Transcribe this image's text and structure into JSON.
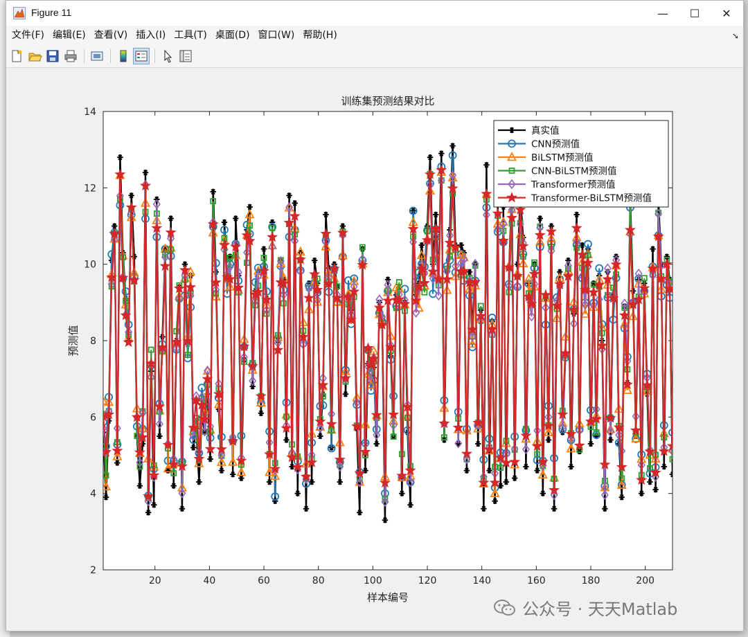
{
  "window": {
    "title": "Figure 11",
    "minimize_label": "—",
    "maximize_label": "☐",
    "close_label": "✕"
  },
  "menu": [
    "文件(F)",
    "编辑(E)",
    "查看(V)",
    "插入(I)",
    "工具(T)",
    "桌面(D)",
    "窗口(W)",
    "帮助(H)"
  ],
  "toolbar": {
    "icons": [
      "new-figure-icon",
      "open-file-icon",
      "save-icon",
      "print-icon",
      "link-plot-icon",
      "insert-colorbar-icon",
      "insert-legend-icon",
      "edit-plot-arrow-icon",
      "property-inspector-icon"
    ]
  },
  "watermark": "公众号 · 天天Matlab",
  "chart_data": {
    "type": "line",
    "title": "训练集预测结果对比",
    "xlabel": "样本编号",
    "ylabel": "预测值",
    "xlim": [
      1,
      210
    ],
    "ylim": [
      2,
      14
    ],
    "xticks": [
      20,
      40,
      60,
      80,
      100,
      120,
      140,
      160,
      180,
      200
    ],
    "yticks": [
      2,
      4,
      6,
      8,
      10,
      12,
      14
    ],
    "grid": false,
    "legend_position": "top-right",
    "series": [
      {
        "name": "真实值",
        "color": "#000000",
        "marker": "asterisk"
      },
      {
        "name": "CNN预测值",
        "color": "#1f77b4",
        "marker": "circle"
      },
      {
        "name": "BiLSTM预测值",
        "color": "#ff7f0e",
        "marker": "triangle"
      },
      {
        "name": "CNN-BiLSTM预测值",
        "color": "#2ca02c",
        "marker": "square"
      },
      {
        "name": "Transformer预测值",
        "color": "#9467bd",
        "marker": "diamond"
      },
      {
        "name": "Transformer-BiLSTM预测值",
        "color": "#d62728",
        "marker": "pentagram"
      }
    ],
    "values_true": [
      5.6,
      3.9,
      5.9,
      10.1,
      11.0,
      4.8,
      12.8,
      10.3,
      9.1,
      8.0,
      11.8,
      10.2,
      5.5,
      4.2,
      5.3,
      12.4,
      3.5,
      7.2,
      3.7,
      11.7,
      5.5,
      8.1,
      10.4,
      4.6,
      11.2,
      4.2,
      8.0,
      9.4,
      3.6,
      10.0,
      7.9,
      9.7,
      5.2,
      5.7,
      4.3,
      6.0,
      5.6,
      6.6,
      4.9,
      11.9,
      9.8,
      6.2,
      4.6,
      11.1,
      9.6,
      10.2,
      4.5,
      11.2,
      9.7,
      4.4,
      7.5,
      10.9,
      11.5,
      6.8,
      9.3,
      9.8,
      6.1,
      10.4,
      9.1,
      4.3,
      11.1,
      3.8,
      8.0,
      10.1,
      9.6,
      5.4,
      11.8,
      4.7,
      11.6,
      4.0,
      10.3,
      8.1,
      3.6,
      9.5,
      4.3,
      10.1,
      9.5,
      5.5,
      6.6,
      11.3,
      9.9,
      5.2,
      10.0,
      9.4,
      4.3,
      11.0,
      6.6,
      9.2,
      8.8,
      9.3,
      5.7,
      3.5,
      10.4,
      4.6,
      7.4,
      6.9,
      7.3,
      5.3,
      9.0,
      8.4,
      3.3,
      9.6,
      7.6,
      5.5,
      9.2,
      9.4,
      4.0,
      9.0,
      5.6,
      3.7,
      11.4,
      9.2,
      9.5,
      10.5,
      9.8,
      11.0,
      12.8,
      10.0,
      11.3,
      9.6,
      12.9,
      5.4,
      9.8,
      10.9,
      13.1,
      10.5,
      5.3,
      10.5,
      10.3,
      4.6,
      9.8,
      8.3,
      10.0,
      5.3,
      8.8,
      3.6,
      12.6,
      4.6,
      8.5,
      3.8,
      11.6,
      4.2,
      11.5,
      4.3,
      9.9,
      11.9,
      4.4,
      10.0,
      11.8,
      10.7,
      4.7,
      9.5,
      9.1,
      10.0,
      4.6,
      11.2,
      4.0,
      9.1,
      5.4,
      11.0,
      3.6,
      8.9,
      9.8,
      5.6,
      7.6,
      10.1,
      4.7,
      8.7,
      11.3,
      5.1,
      10.5,
      9.3,
      10.4,
      5.3,
      9.5,
      5.5,
      9.7,
      8.0,
      3.6,
      9.8,
      5.4,
      9.2,
      10.2,
      5.3,
      3.9,
      8.9,
      6.9,
      11.7,
      9.3,
      5.5,
      9.6,
      4.0,
      9.5,
      6.6,
      4.3,
      10.4,
      4.1,
      11.7,
      10.0,
      4.7,
      10.2,
      9.6,
      4.5
    ]
  }
}
